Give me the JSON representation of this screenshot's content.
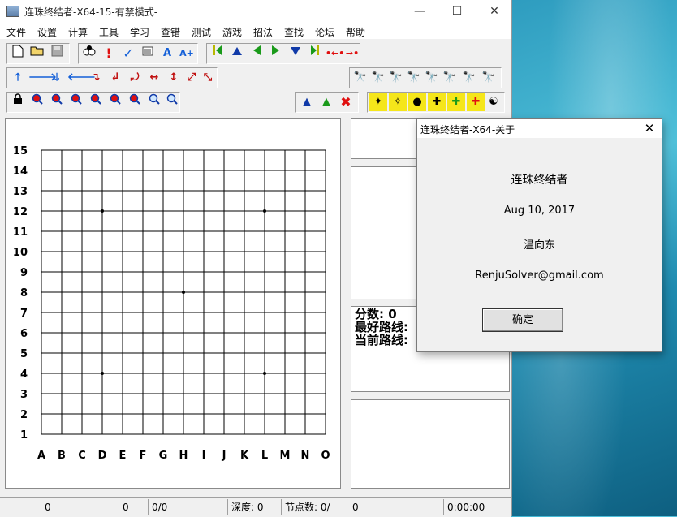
{
  "window": {
    "title": "连珠终结者-X64-15-有禁模式-",
    "minimize": "—",
    "maximize": "☐",
    "close": "✕"
  },
  "menu": [
    "文件",
    "设置",
    "计算",
    "工具",
    "学习",
    "查错",
    "测试",
    "游戏",
    "招法",
    "查找",
    "论坛",
    "帮助"
  ],
  "board": {
    "rows": [
      "15",
      "14",
      "13",
      "12",
      "11",
      "10",
      "9",
      "8",
      "7",
      "6",
      "5",
      "4",
      "3",
      "2",
      "1"
    ],
    "cols": [
      "A",
      "B",
      "C",
      "D",
      "E",
      "F",
      "G",
      "H",
      "I",
      "J",
      "K",
      "L",
      "M",
      "N",
      "O"
    ],
    "star_points": [
      "D12",
      "L12",
      "H8",
      "D4",
      "L4"
    ]
  },
  "info": {
    "score_label": "分数:",
    "score_value": "0",
    "best_line_label": "最好路线:",
    "current_line_label": "当前路线:"
  },
  "status": {
    "cell1": "0",
    "cell2": "0",
    "cell3": "0/0",
    "depth": "深度: 0",
    "nodes": "节点数: 0/",
    "nodes_val": "0",
    "time": "0:00:00"
  },
  "dialog": {
    "title": "连珠终结者-X64-关于",
    "close": "✕",
    "app_name": "连珠终结者",
    "date": "Aug 10, 2017",
    "author": "温向东",
    "email": "RenjuSolver@gmail.com",
    "ok_label": "确定"
  },
  "toolbar_icons": {
    "row1": [
      "new-file-icon",
      "open-folder-icon",
      "save-icon",
      "stones-icon",
      "exclamation-icon",
      "check-icon",
      "board-icon",
      "font-a-icon",
      "font-a-plus-icon",
      "first-move-icon",
      "up-triangle-icon",
      "back-icon",
      "forward-icon",
      "down-triangle-icon",
      "last-move-icon",
      "jump-back-icon",
      "jump-forward-icon",
      "search-icons"
    ],
    "colors": {
      "accent_blue": "#1560d8",
      "red": "#e01010",
      "green": "#1a9a1a",
      "yellow": "#f5e61a"
    }
  }
}
